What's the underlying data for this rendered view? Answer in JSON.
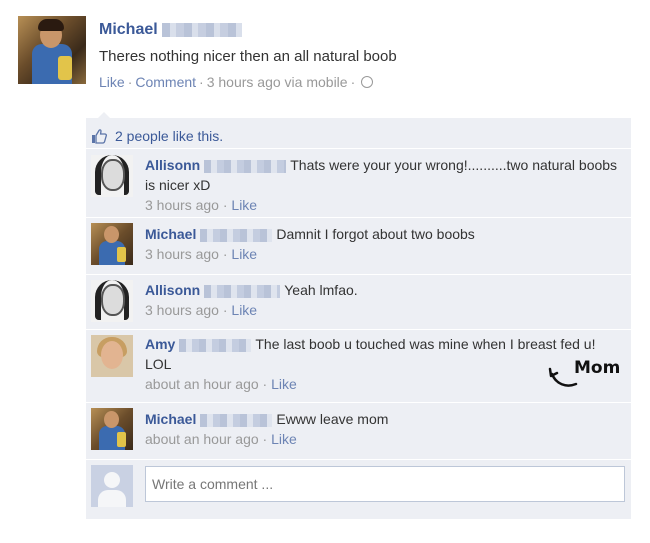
{
  "post": {
    "author": "Michael",
    "text": "Theres nothing nicer then an all natural boob",
    "like_label": "Like",
    "comment_label": "Comment",
    "timestamp": "3 hours ago via mobile"
  },
  "likes": {
    "text": "2 people like this."
  },
  "comments": [
    {
      "author": "Allisonn",
      "text": "Thats were your your wrong!..........two natural boobs is nicer xD",
      "time": "3 hours ago",
      "like_label": "Like"
    },
    {
      "author": "Michael",
      "text": "Damnit I forgot about two boobs",
      "time": "3 hours ago",
      "like_label": "Like"
    },
    {
      "author": "Allisonn",
      "text": "Yeah lmfao.",
      "time": "3 hours ago",
      "like_label": "Like"
    },
    {
      "author": "Amy",
      "text": "The last boob u touched was mine when I breast fed u! LOL",
      "time": "about an hour ago",
      "like_label": "Like"
    },
    {
      "author": "Michael",
      "text": "Ewww leave mom",
      "time": "about an hour ago",
      "like_label": "Like"
    }
  ],
  "annotation": {
    "label": "Mom"
  },
  "composer": {
    "placeholder": "Write a comment ..."
  },
  "colors": {
    "link": "#3b5998",
    "meta_link": "#6d84b4",
    "ufi_background": "#edeff4"
  }
}
